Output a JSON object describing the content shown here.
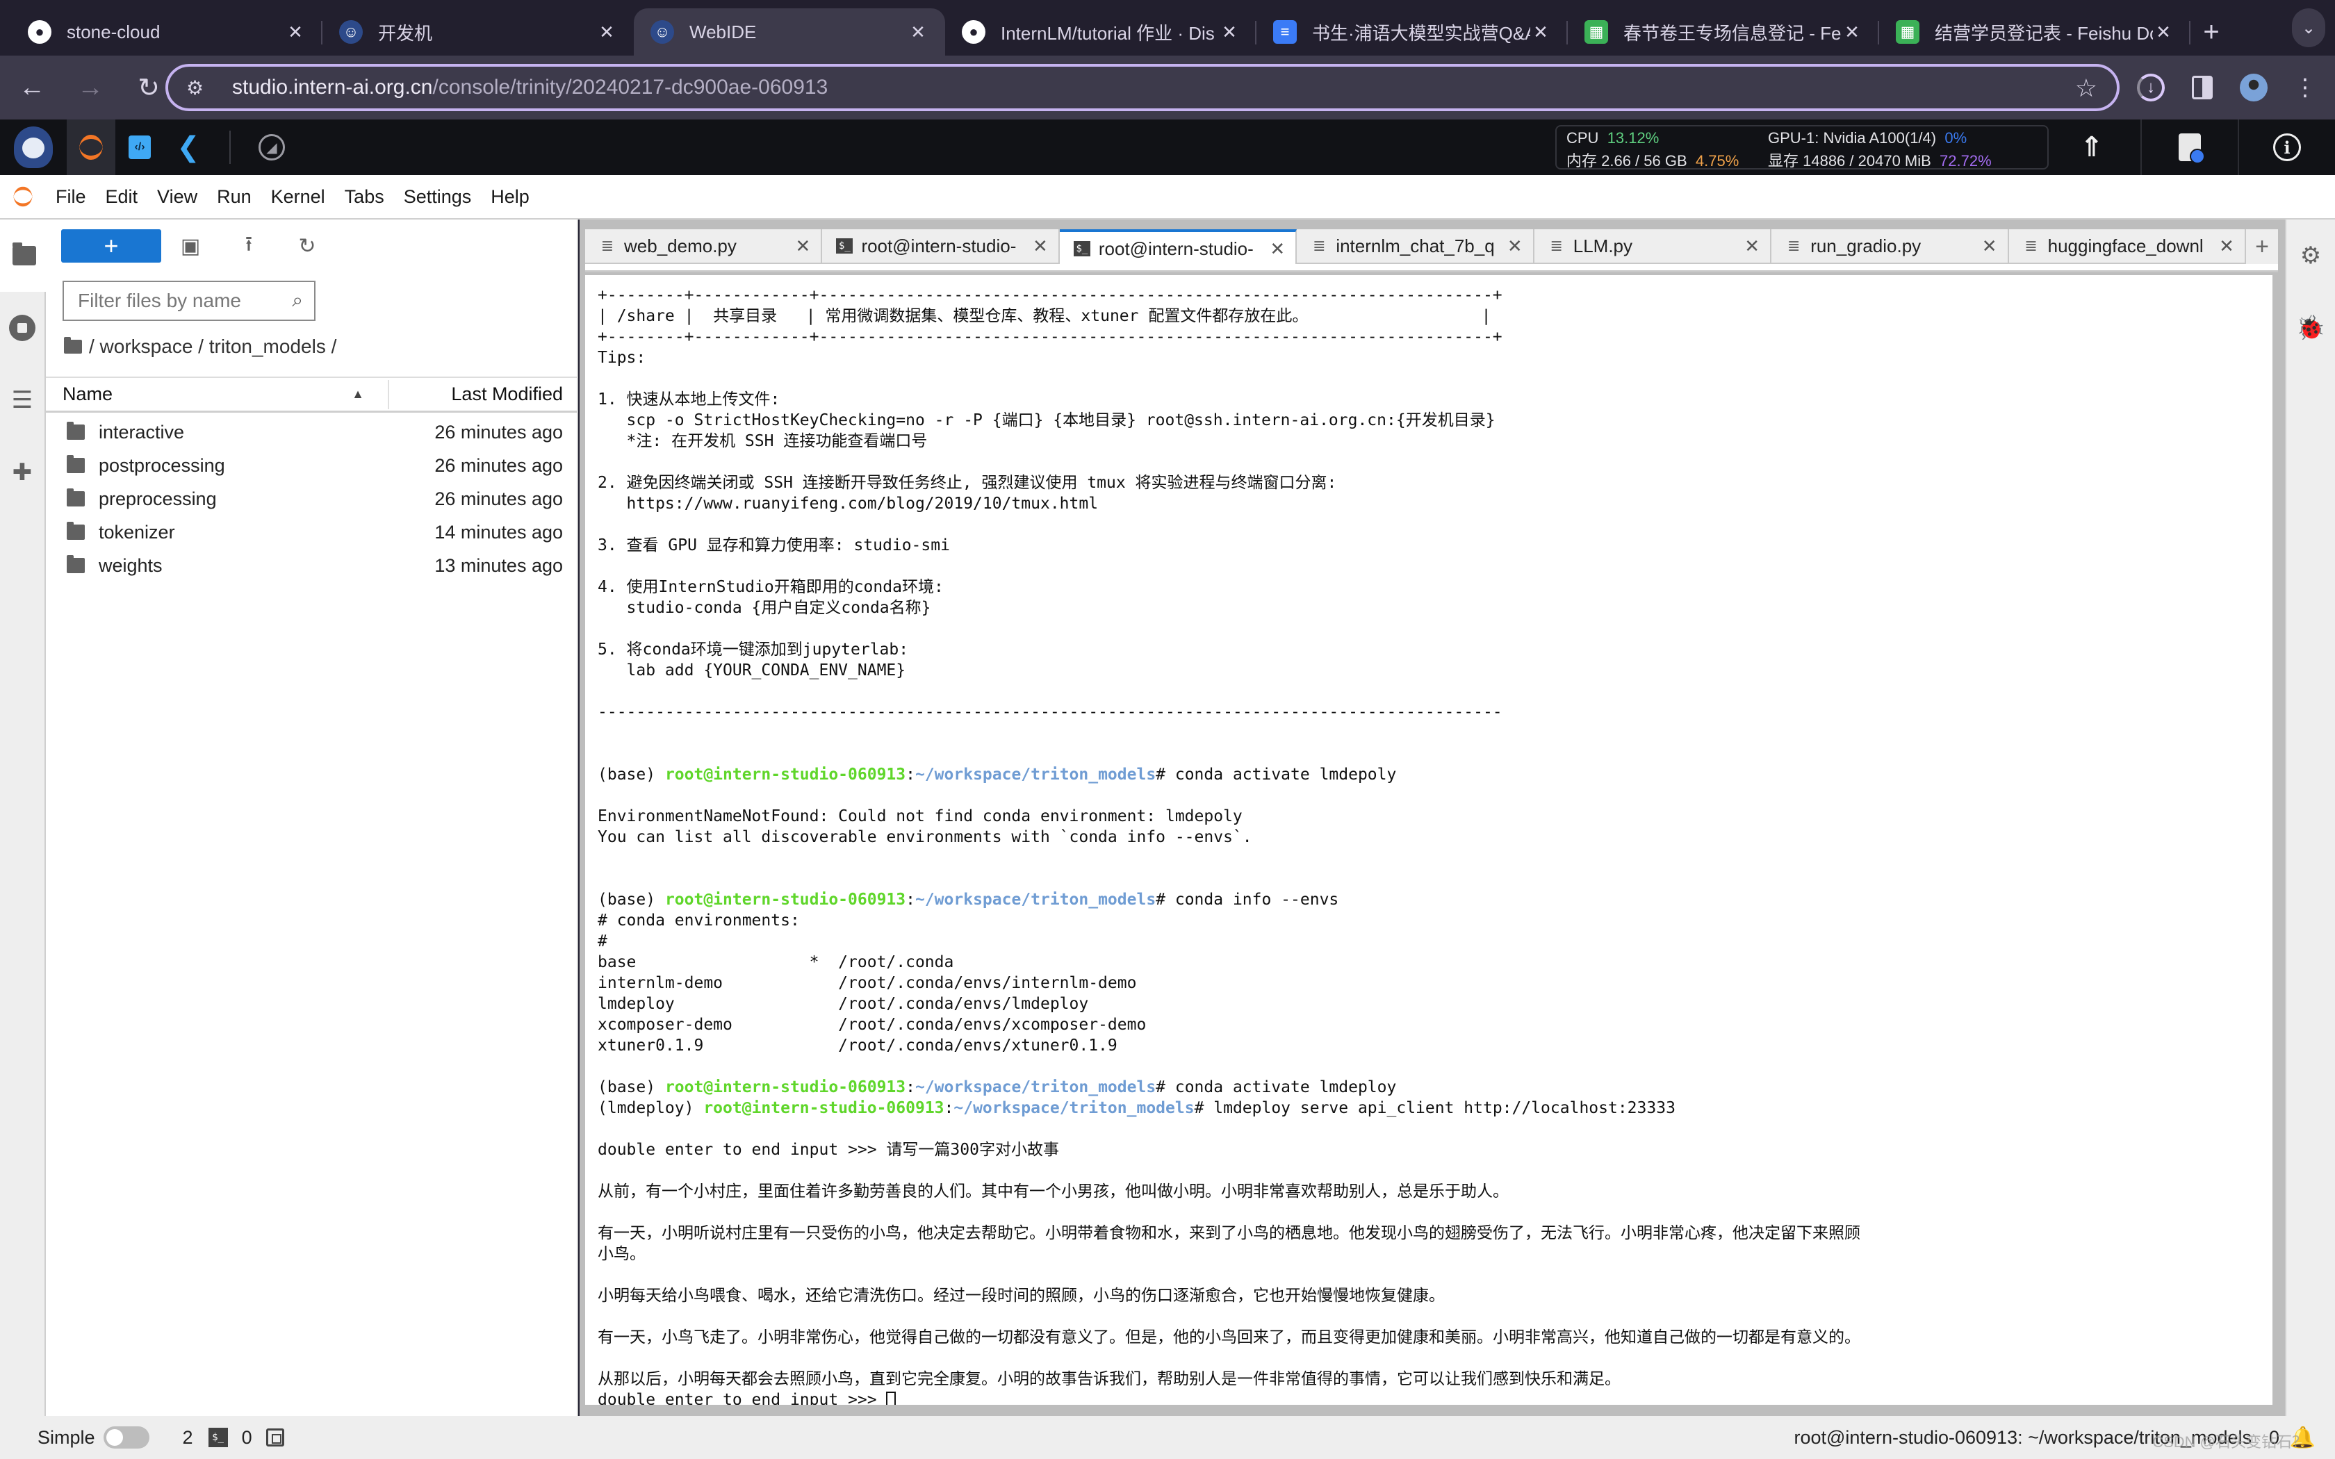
{
  "browser": {
    "tabs": [
      {
        "title": "stone-cloud",
        "favicon": "github-icon",
        "active": false
      },
      {
        "title": "开发机",
        "favicon": "internlm-icon",
        "active": false
      },
      {
        "title": "WebIDE",
        "favicon": "internlm-icon",
        "active": true
      },
      {
        "title": "InternLM/tutorial 作业 · Dis",
        "favicon": "github-icon",
        "active": false
      },
      {
        "title": "书生·浦语大模型实战营Q&A",
        "favicon": "doc-icon",
        "active": false
      },
      {
        "title": "春节卷王专场信息登记 - Fei",
        "favicon": "sheet-icon",
        "active": false
      },
      {
        "title": "结营学员登记表 - Feishu Do",
        "favicon": "sheet-icon",
        "active": false
      }
    ],
    "new_tab_label": "+",
    "url_host": "studio.intern-ai.org.cn",
    "url_path": "/console/trinity/20240217-dc900ae-060913"
  },
  "studio": {
    "metrics": {
      "cpu_label": "CPU",
      "cpu_value": "13.12%",
      "gpu_label": "GPU-1: Nvidia A100(1/4)",
      "gpu_value": "0%",
      "mem_label": "内存 2.66 / 56 GB",
      "mem_value": "4.75%",
      "vram_label": "显存 14886 / 20470 MiB",
      "vram_value": "72.72%"
    },
    "colors": {
      "cpu": "#5fcf80",
      "gpu": "#3a7af0",
      "mem": "#f0a24a",
      "vram": "#a36cf0"
    }
  },
  "menu": [
    "File",
    "Edit",
    "View",
    "Run",
    "Kernel",
    "Tabs",
    "Settings",
    "Help"
  ],
  "filebrowser": {
    "new_button": "+",
    "filter_placeholder": "Filter files by name",
    "breadcrumb": "/ workspace / triton_models /",
    "col_name": "Name",
    "col_modified": "Last Modified",
    "items": [
      {
        "name": "interactive",
        "modified": "26 minutes ago"
      },
      {
        "name": "postprocessing",
        "modified": "26 minutes ago"
      },
      {
        "name": "preprocessing",
        "modified": "26 minutes ago"
      },
      {
        "name": "tokenizer",
        "modified": "14 minutes ago"
      },
      {
        "name": "weights",
        "modified": "13 minutes ago"
      }
    ]
  },
  "doctabs": [
    {
      "title": "web_demo.py",
      "type": "file",
      "active": false
    },
    {
      "title": "root@intern-studio-",
      "type": "terminal",
      "active": false
    },
    {
      "title": "root@intern-studio-",
      "type": "terminal",
      "active": true
    },
    {
      "title": "internlm_chat_7b_q",
      "type": "file",
      "active": false
    },
    {
      "title": "LLM.py",
      "type": "file",
      "active": false
    },
    {
      "title": "run_gradio.py",
      "type": "file",
      "active": false
    },
    {
      "title": "huggingface_downl",
      "type": "file",
      "active": false
    }
  ],
  "terminal": {
    "lines": [
      {
        "t": "+--------+------------+----------------------------------------------------------------------+"
      },
      {
        "t": "| /share |  共享目录   | 常用微调数据集、模型仓库、教程、xtuner 配置文件都存放在此。                  |"
      },
      {
        "t": "+--------+------------+----------------------------------------------------------------------+"
      },
      {
        "t": "Tips:"
      },
      {
        "t": ""
      },
      {
        "t": "1. 快速从本地上传文件:"
      },
      {
        "t": "   scp -o StrictHostKeyChecking=no -r -P {端口} {本地目录} root@ssh.intern-ai.org.cn:{开发机目录}"
      },
      {
        "t": "   *注: 在开发机 SSH 连接功能查看端口号"
      },
      {
        "t": ""
      },
      {
        "t": "2. 避免因终端关闭或 SSH 连接断开导致任务终止, 强烈建议使用 tmux 将实验进程与终端窗口分离:"
      },
      {
        "t": "   https://www.ruanyifeng.com/blog/2019/10/tmux.html"
      },
      {
        "t": ""
      },
      {
        "t": "3. 查看 GPU 显存和算力使用率: studio-smi"
      },
      {
        "t": ""
      },
      {
        "t": "4. 使用InternStudio开箱即用的conda环境:"
      },
      {
        "t": "   studio-conda {用户自定义conda名称}"
      },
      {
        "t": ""
      },
      {
        "t": "5. 将conda环境一键添加到jupyterlab:"
      },
      {
        "t": "   lab add {YOUR_CONDA_ENV_NAME}"
      },
      {
        "t": ""
      },
      {
        "t": "----------------------------------------------------------------------------------------------"
      },
      {
        "t": ""
      },
      {
        "t": ""
      },
      {
        "env": "(base) ",
        "user": "root@intern-studio-060913",
        "path": "~/workspace/triton_models",
        "cmd": "# conda activate lmdepoly"
      },
      {
        "t": ""
      },
      {
        "t": "EnvironmentNameNotFound: Could not find conda environment: lmdepoly"
      },
      {
        "t": "You can list all discoverable environments with `conda info --envs`."
      },
      {
        "t": ""
      },
      {
        "t": ""
      },
      {
        "env": "(base) ",
        "user": "root@intern-studio-060913",
        "path": "~/workspace/triton_models",
        "cmd": "# conda info --envs"
      },
      {
        "t": "# conda environments:"
      },
      {
        "t": "#"
      },
      {
        "t": "base                  *  /root/.conda"
      },
      {
        "t": "internlm-demo            /root/.conda/envs/internlm-demo"
      },
      {
        "t": "lmdeploy                 /root/.conda/envs/lmdeploy"
      },
      {
        "t": "xcomposer-demo           /root/.conda/envs/xcomposer-demo"
      },
      {
        "t": "xtuner0.1.9              /root/.conda/envs/xtuner0.1.9"
      },
      {
        "t": ""
      },
      {
        "env": "(base) ",
        "user": "root@intern-studio-060913",
        "path": "~/workspace/triton_models",
        "cmd": "# conda activate lmdeploy"
      },
      {
        "env": "(lmdeploy) ",
        "user": "root@intern-studio-060913",
        "path": "~/workspace/triton_models",
        "cmd": "# lmdeploy serve api_client http://localhost:23333"
      },
      {
        "t": ""
      },
      {
        "t": "double enter to end input >>> 请写一篇300字对小故事"
      },
      {
        "t": ""
      },
      {
        "t": "从前，有一个小村庄，里面住着许多勤劳善良的人们。其中有一个小男孩，他叫做小明。小明非常喜欢帮助别人，总是乐于助人。"
      },
      {
        "t": ""
      },
      {
        "t": "有一天，小明听说村庄里有一只受伤的小鸟，他决定去帮助它。小明带着食物和水，来到了小鸟的栖息地。他发现小鸟的翅膀受伤了，无法飞行。小明非常心疼，他决定留下来照顾"
      },
      {
        "t": "小鸟。"
      },
      {
        "t": ""
      },
      {
        "t": "小明每天给小鸟喂食、喝水，还给它清洗伤口。经过一段时间的照顾，小鸟的伤口逐渐愈合，它也开始慢慢地恢复健康。"
      },
      {
        "t": ""
      },
      {
        "t": "有一天，小鸟飞走了。小明非常伤心，他觉得自己做的一切都没有意义了。但是，他的小鸟回来了，而且变得更加健康和美丽。小明非常高兴，他知道自己做的一切都是有意义的。"
      },
      {
        "t": ""
      },
      {
        "t": "从那以后，小明每天都会去照顾小鸟，直到它完全康复。小明的故事告诉我们，帮助别人是一件非常值得的事情，它可以让我们感到快乐和满足。"
      },
      {
        "t": "double enter to end input >>> ",
        "cursor": true
      }
    ]
  },
  "statusbar": {
    "mode_label": "Simple",
    "kernels_count": "2",
    "terminals_count": "0",
    "path": "root@intern-studio-060913: ~/workspace/triton_models",
    "notifications": "0",
    "watermark": "CSDN @石头变钻石？"
  }
}
